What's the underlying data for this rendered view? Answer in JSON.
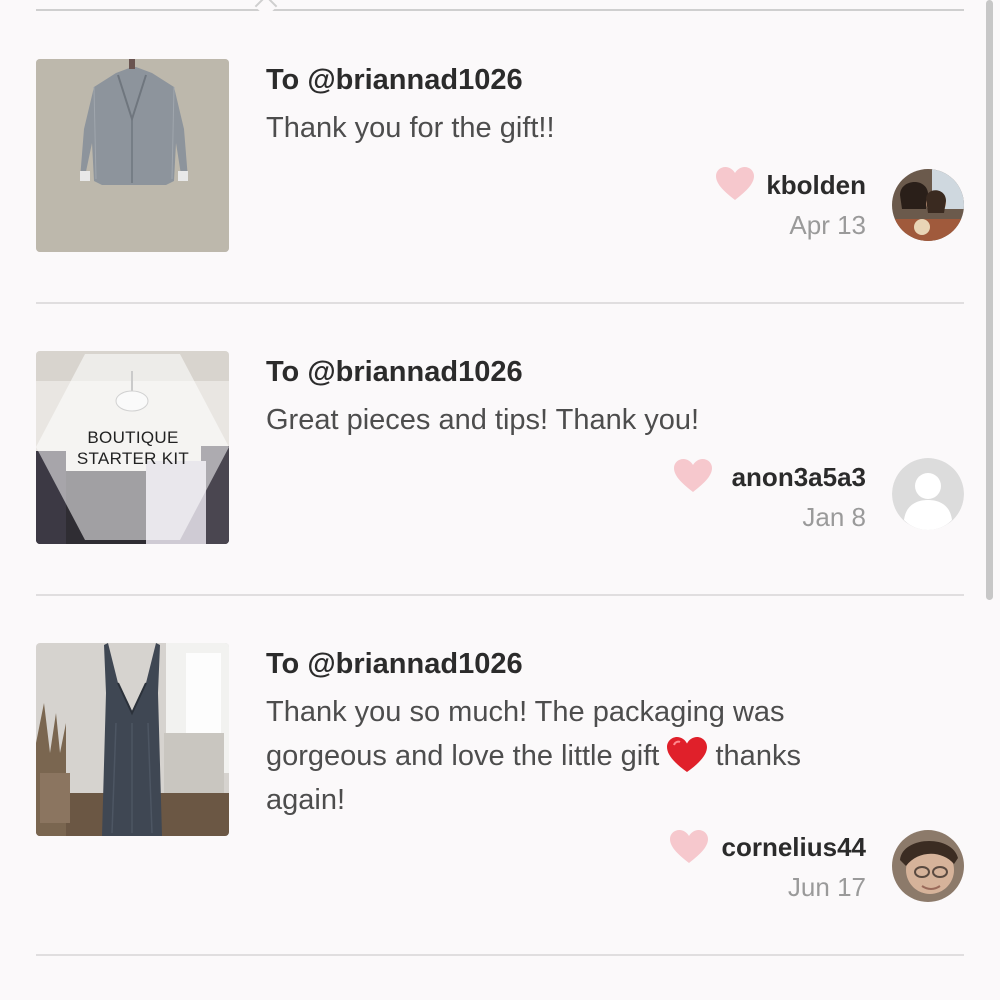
{
  "reviews": [
    {
      "to": "To @briannad1026",
      "message": "Thank you for the gift!!",
      "username": "kbolden",
      "date": "Apr 13",
      "thumbnail_icon": "blazer-photo",
      "avatar_icon": "user-photo"
    },
    {
      "to": "To @briannad1026",
      "message": "Great pieces and tips! Thank you!",
      "username": "anon3a5a3",
      "date": "Jan 8",
      "thumbnail_icon": "boutique-starter-kit-photo",
      "thumbnail_label_1": "BOUTIQUE",
      "thumbnail_label_2": "STARTER KIT",
      "avatar_icon": "default-avatar"
    },
    {
      "to": "To @briannad1026",
      "message_line_1": "Thank you so much! The packaging was",
      "message_line_2a": "gorgeous and love the little gift",
      "message_line_2b": "thanks",
      "message_line_3": "again!",
      "username": "cornelius44",
      "date": "Jun 17",
      "thumbnail_icon": "dress-photo",
      "avatar_icon": "user-photo"
    }
  ],
  "colors": {
    "background": "#fbf9fa",
    "heart_like": "#f6c8cd",
    "heart_emoji": "#e0202a",
    "muted_text": "#9a9a9a"
  }
}
